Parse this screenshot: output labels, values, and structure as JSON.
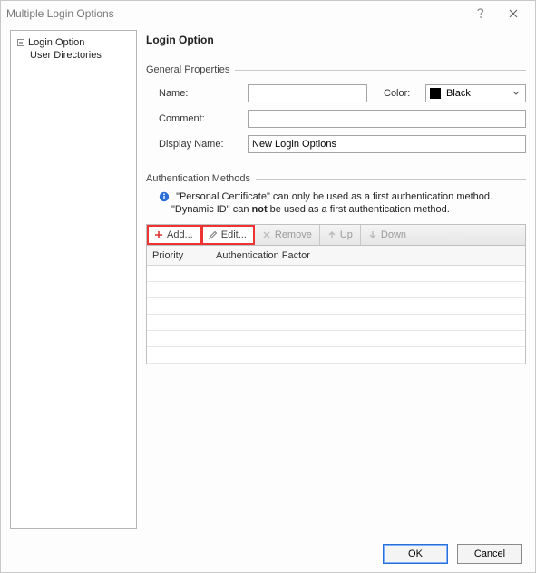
{
  "window": {
    "title": "Multiple Login Options"
  },
  "tree": {
    "root": "Login Option",
    "child": "User Directories"
  },
  "page": {
    "title": "Login Option"
  },
  "sections": {
    "general": "General Properties",
    "auth": "Authentication Methods"
  },
  "fields": {
    "name_label": "Name:",
    "name_value": "",
    "color_label": "Color:",
    "color_value": "Black",
    "comment_label": "Comment:",
    "comment_value": "",
    "display_label": "Display Name:",
    "display_value": "New Login Options"
  },
  "hints": {
    "line1": "\"Personal Certificate\" can only be used as a first authentication method.",
    "line2_a": "\"Dynamic ID\" can ",
    "line2_b": "not",
    "line2_c": " be used as a first authentication method."
  },
  "toolbar": {
    "add": "Add...",
    "edit": "Edit...",
    "remove": "Remove",
    "up": "Up",
    "down": "Down"
  },
  "grid": {
    "col_priority": "Priority",
    "col_factor": "Authentication Factor"
  },
  "footer": {
    "ok": "OK",
    "cancel": "Cancel"
  }
}
